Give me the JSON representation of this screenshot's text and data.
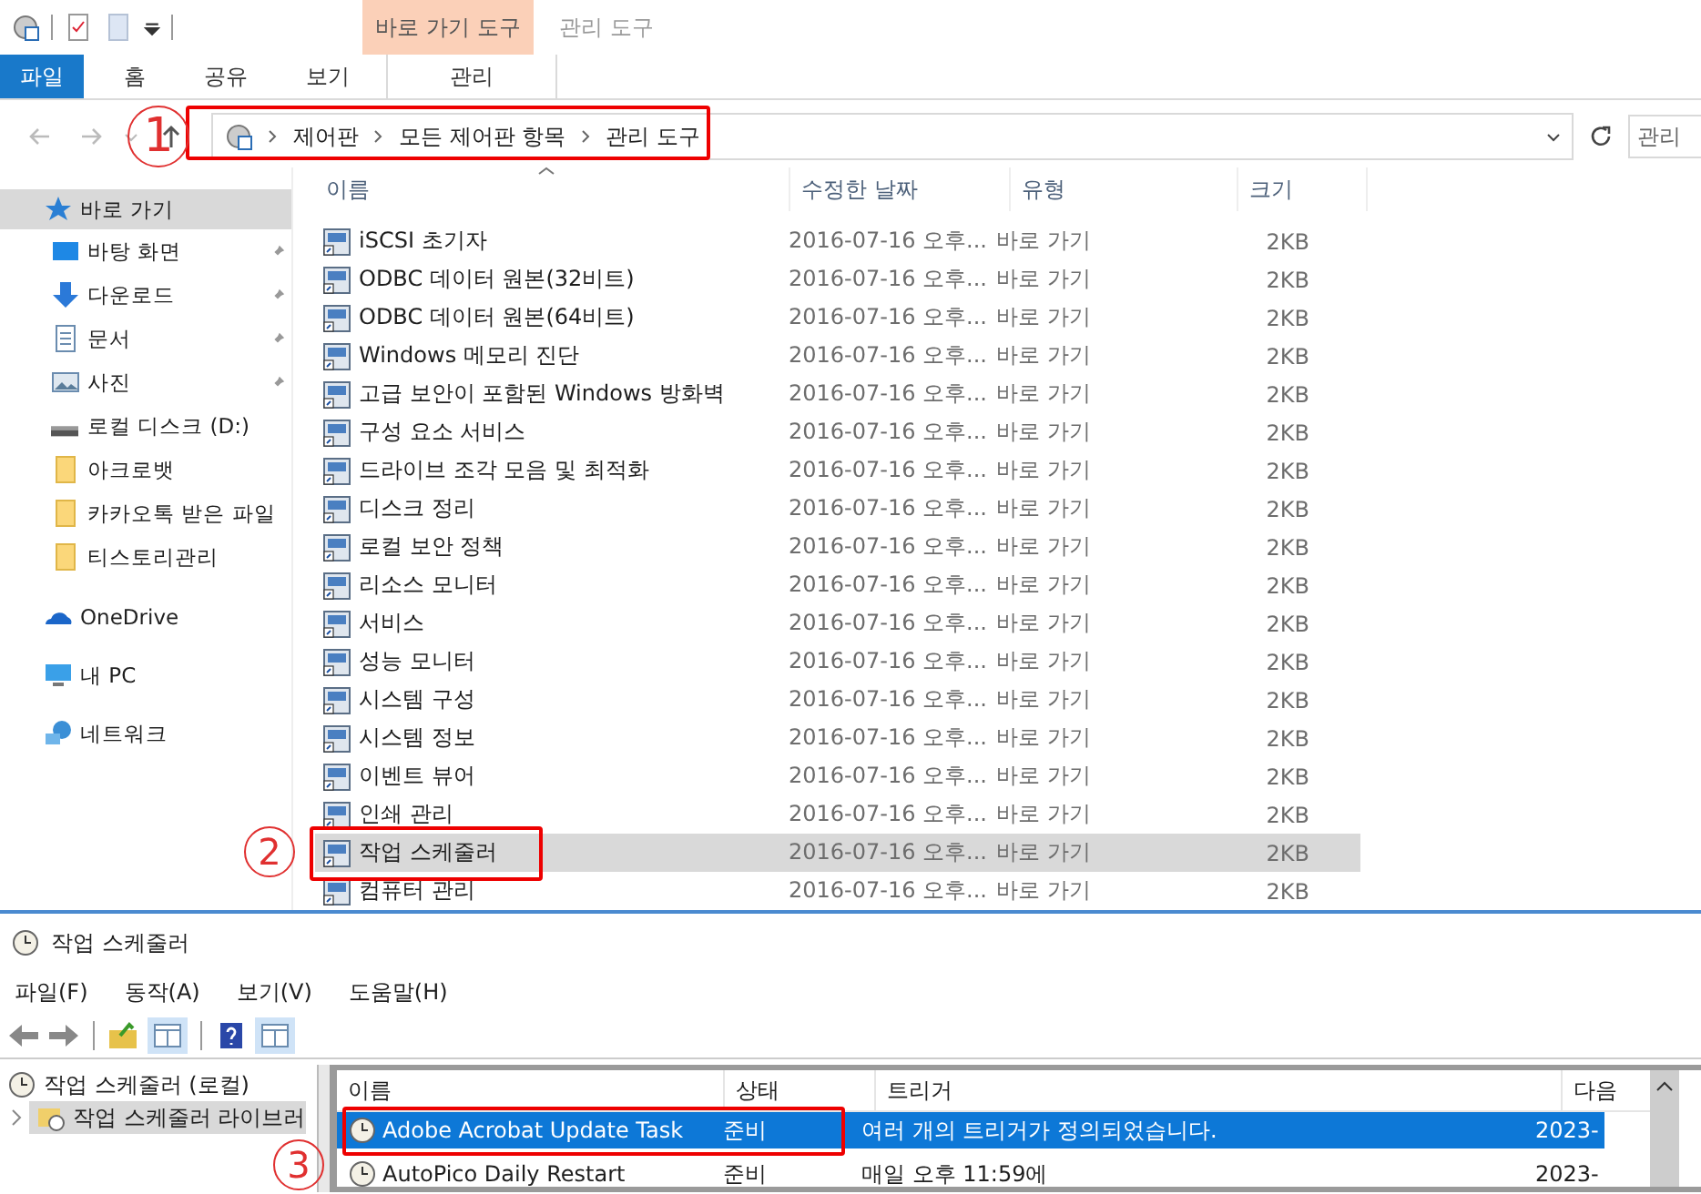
{
  "ribbon": {
    "context_group": "바로 가기 도구",
    "context_title": "관리 도구",
    "tabs": [
      {
        "label": "파일",
        "kind": "file"
      },
      {
        "label": "홈",
        "kind": "normal"
      },
      {
        "label": "공유",
        "kind": "normal"
      },
      {
        "label": "보기",
        "kind": "normal"
      },
      {
        "label": "관리",
        "kind": "context"
      }
    ]
  },
  "address_bar": {
    "breadcrumbs": [
      "제어판",
      "모든 제어판 항목",
      "관리 도구"
    ],
    "search_placeholder": "관리"
  },
  "sidebar": {
    "items": [
      {
        "label": "바로 가기",
        "selected": true,
        "children": [
          {
            "label": "바탕 화면",
            "pinned": true,
            "selected": false
          },
          {
            "label": "다운로드",
            "pinned": true,
            "selected": false
          },
          {
            "label": "문서",
            "pinned": true,
            "selected": false
          },
          {
            "label": "사진",
            "pinned": true,
            "selected": false
          },
          {
            "label": "로컬 디스크 (D:)",
            "pinned": false,
            "selected": false
          },
          {
            "label": "아크로뱃",
            "pinned": false,
            "selected": false
          },
          {
            "label": "카카오톡 받은 파일",
            "pinned": false,
            "selected": false
          },
          {
            "label": "티스토리관리",
            "pinned": false,
            "selected": false
          }
        ]
      },
      {
        "label": "OneDrive",
        "selected": false
      },
      {
        "label": "내 PC",
        "selected": false
      },
      {
        "label": "네트워크",
        "selected": false
      }
    ]
  },
  "file_list": {
    "columns": [
      "이름",
      "수정한 날짜",
      "유형",
      "크기"
    ],
    "rows": [
      {
        "name": "iSCSI 초기자",
        "date": "2016-07-16 오후...",
        "type": "바로 가기",
        "size": "2KB",
        "selected": false
      },
      {
        "name": "ODBC 데이터 원본(32비트)",
        "date": "2016-07-16 오후...",
        "type": "바로 가기",
        "size": "2KB",
        "selected": false
      },
      {
        "name": "ODBC 데이터 원본(64비트)",
        "date": "2016-07-16 오후...",
        "type": "바로 가기",
        "size": "2KB",
        "selected": false
      },
      {
        "name": "Windows 메모리 진단",
        "date": "2016-07-16 오후...",
        "type": "바로 가기",
        "size": "2KB",
        "selected": false
      },
      {
        "name": "고급 보안이 포함된 Windows 방화벽",
        "date": "2016-07-16 오후...",
        "type": "바로 가기",
        "size": "2KB",
        "selected": false
      },
      {
        "name": "구성 요소 서비스",
        "date": "2016-07-16 오후...",
        "type": "바로 가기",
        "size": "2KB",
        "selected": false
      },
      {
        "name": "드라이브 조각 모음 및 최적화",
        "date": "2016-07-16 오후...",
        "type": "바로 가기",
        "size": "2KB",
        "selected": false
      },
      {
        "name": "디스크 정리",
        "date": "2016-07-16 오후...",
        "type": "바로 가기",
        "size": "2KB",
        "selected": false
      },
      {
        "name": "로컬 보안 정책",
        "date": "2016-07-16 오후...",
        "type": "바로 가기",
        "size": "2KB",
        "selected": false
      },
      {
        "name": "리소스 모니터",
        "date": "2016-07-16 오후...",
        "type": "바로 가기",
        "size": "2KB",
        "selected": false
      },
      {
        "name": "서비스",
        "date": "2016-07-16 오후...",
        "type": "바로 가기",
        "size": "2KB",
        "selected": false
      },
      {
        "name": "성능 모니터",
        "date": "2016-07-16 오후...",
        "type": "바로 가기",
        "size": "2KB",
        "selected": false
      },
      {
        "name": "시스템 구성",
        "date": "2016-07-16 오후...",
        "type": "바로 가기",
        "size": "2KB",
        "selected": false
      },
      {
        "name": "시스템 정보",
        "date": "2016-07-16 오후...",
        "type": "바로 가기",
        "size": "2KB",
        "selected": false
      },
      {
        "name": "이벤트 뷰어",
        "date": "2016-07-16 오후...",
        "type": "바로 가기",
        "size": "2KB",
        "selected": false
      },
      {
        "name": "인쇄 관리",
        "date": "2016-07-16 오후...",
        "type": "바로 가기",
        "size": "2KB",
        "selected": false
      },
      {
        "name": "작업 스케줄러",
        "date": "2016-07-16 오후...",
        "type": "바로 가기",
        "size": "2KB",
        "selected": true
      },
      {
        "name": "컴퓨터 관리",
        "date": "2016-07-16 오후...",
        "type": "바로 가기",
        "size": "2KB",
        "selected": false
      }
    ]
  },
  "task_scheduler": {
    "title": "작업 스케줄러",
    "menu": [
      "파일(F)",
      "동작(A)",
      "보기(V)",
      "도움말(H)"
    ],
    "tree": [
      {
        "label": "작업 스케줄러 (로컬)",
        "selected": false,
        "children": [
          {
            "label": "작업 스케줄러 라이브러",
            "selected": true,
            "expanded": false
          }
        ]
      }
    ],
    "columns": [
      "이름",
      "상태",
      "트리거",
      "다음"
    ],
    "rows": [
      {
        "name": "Adobe Acrobat Update Task",
        "status": "준비",
        "trigger": "여러 개의 트리거가 정의되었습니다.",
        "next_run": "2023-",
        "selected": true
      },
      {
        "name": "AutoPico Daily Restart",
        "status": "준비",
        "trigger": "매일 오후 11:59에",
        "next_run": "2023-",
        "selected": false
      }
    ]
  },
  "annotations": [
    {
      "label": "1"
    },
    {
      "label": "2"
    },
    {
      "label": "3"
    }
  ]
}
